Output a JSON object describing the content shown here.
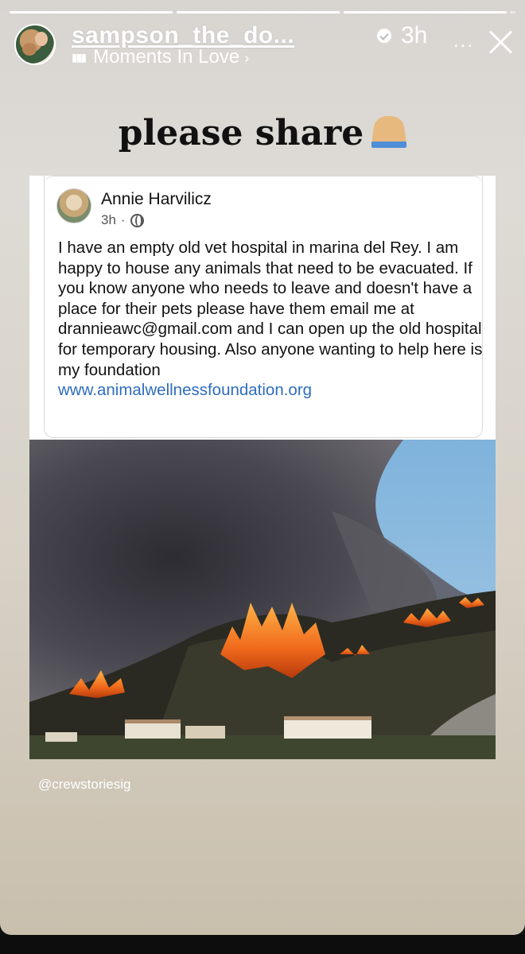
{
  "story": {
    "progress": [
      1,
      1,
      1,
      0.05
    ],
    "username": "sampson_the_do...",
    "time_ago": "3h",
    "more_label": "...",
    "music_label": "Moments In Love",
    "music_chevron": "›",
    "title": "please share",
    "title_emoji": "folded-hands-icon",
    "handle": "@crewstoriesig"
  },
  "post": {
    "author": "Annie Harvilicz",
    "time": "3h",
    "separator": "·",
    "privacy_icon": "globe-icon",
    "body": "I have an empty old vet hospital in marina del Rey. I am happy to house any animals that need to be evacuated. If you know anyone who needs to leave and doesn't have a place for their pets please have them email me at drannieawc@gmail.com and I can open up the old hospital for temporary housing. Also anyone wanting to help here is my foundation",
    "link": "www.animalwellnessfoundation.org",
    "link_color": "#2f6dbd"
  },
  "colors": {
    "story_bg_top": "#d8d5d1",
    "story_bg_bottom": "#c9bfad",
    "fire": "#f06a1c",
    "smoke": "#3d3b42",
    "sky": "#7fb3dc"
  }
}
